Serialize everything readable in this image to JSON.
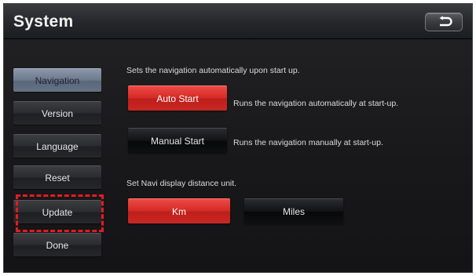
{
  "header": {
    "title": "System",
    "back_icon": "back-arrow-icon"
  },
  "sidebar": {
    "items": [
      {
        "label": "Navigation",
        "active": true
      },
      {
        "label": "Version",
        "active": false
      },
      {
        "label": "Language",
        "active": false
      },
      {
        "label": "Reset",
        "active": false
      },
      {
        "label": "Update",
        "active": false,
        "highlighted": true
      },
      {
        "label": "Done",
        "active": false
      }
    ]
  },
  "main": {
    "autostart_desc": "Sets the navigation automatically upon start up.",
    "auto_start": {
      "label": "Auto Start",
      "desc": "Runs the navigation automatically at start-up.",
      "selected": true
    },
    "manual_start": {
      "label": "Manual Start",
      "desc": "Runs the navigation manually at start-up.",
      "selected": false
    },
    "distance_desc": "Set Navi display distance unit.",
    "km": {
      "label": "Km",
      "selected": true
    },
    "miles": {
      "label": "Miles",
      "selected": false
    }
  },
  "colors": {
    "accent_red": "#d52a26",
    "highlight_dashed": "#e31b23",
    "active_tab": "#6d7a8e"
  }
}
